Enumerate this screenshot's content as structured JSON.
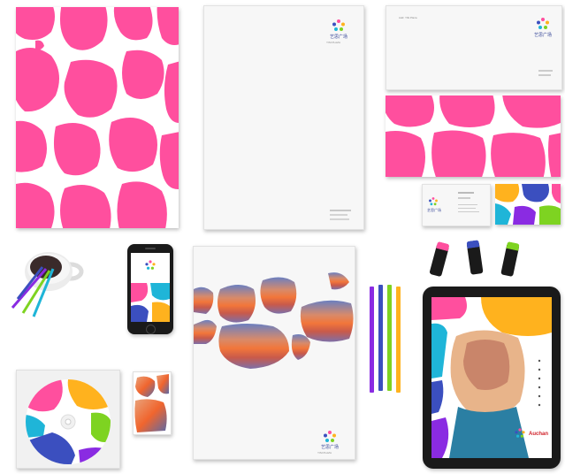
{
  "brand": {
    "name": "艺思广场",
    "tagline": "YISI PLAZA",
    "envelope_address": "Add: YiSi Plaza"
  },
  "colors": {
    "pink": "#ff4f9e",
    "blue": "#3b4fbf",
    "yellow": "#ffb21e",
    "green": "#7ed321",
    "teal": "#1fb5d8",
    "purple": "#8a2be2",
    "sunset_orange": "#f07a3a",
    "sunset_blue": "#5a7bb8"
  },
  "items": [
    {
      "name": "folder-pink-pattern"
    },
    {
      "name": "letterhead"
    },
    {
      "name": "envelope"
    },
    {
      "name": "envelope-pink-flap"
    },
    {
      "name": "business-card-front"
    },
    {
      "name": "business-card-back"
    },
    {
      "name": "coffee-mug-with-pencils"
    },
    {
      "name": "smartphone"
    },
    {
      "name": "brochure-cover"
    },
    {
      "name": "colored-pencils"
    },
    {
      "name": "usb-drives"
    },
    {
      "name": "tablet"
    },
    {
      "name": "cd-disc"
    },
    {
      "name": "small-card"
    }
  ],
  "tablet_brand_text": "Auchan"
}
